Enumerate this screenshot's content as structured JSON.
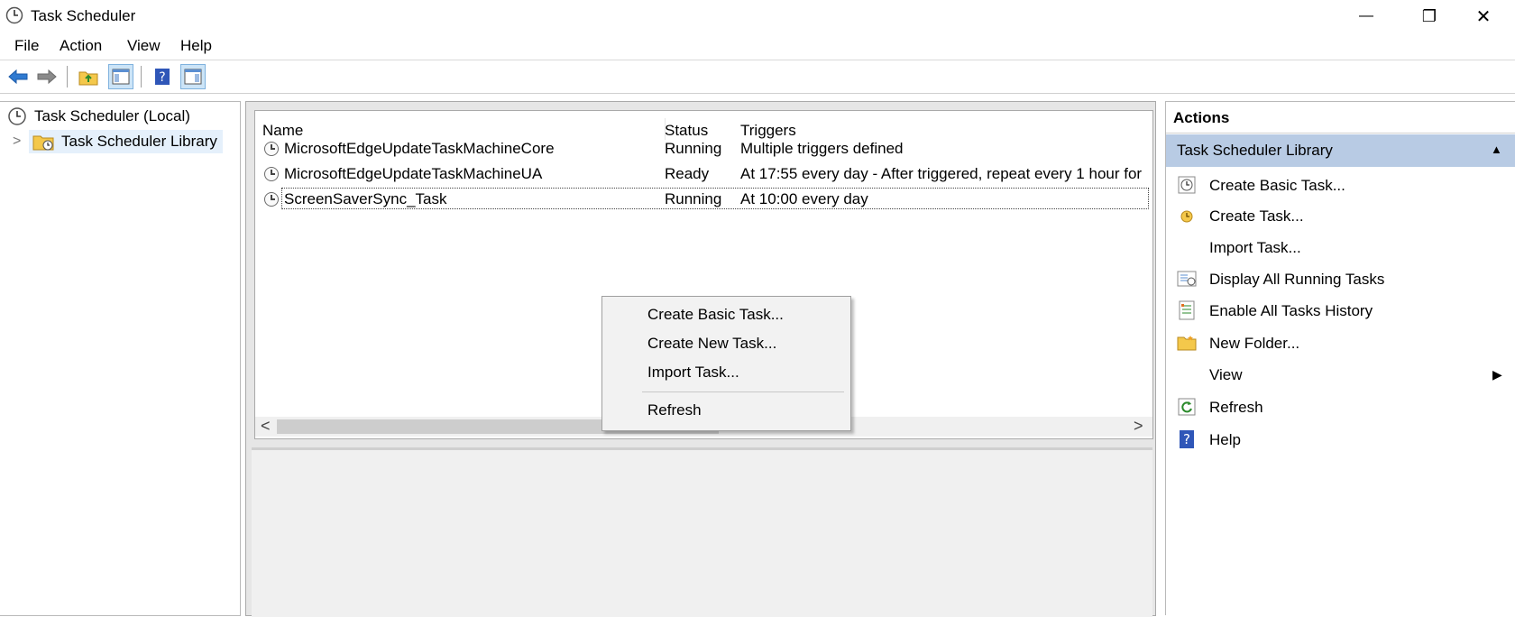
{
  "window": {
    "title": "Task Scheduler",
    "minimize_glyph": "—",
    "restore_glyph": "❐",
    "close_glyph": "✕"
  },
  "menu": [
    "File",
    "Action",
    "View",
    "Help"
  ],
  "tree": {
    "root": "Task Scheduler (Local)",
    "child": "Task Scheduler Library",
    "expander": ">"
  },
  "task_list": {
    "columns": [
      "Name",
      "Status",
      "Triggers"
    ],
    "rows": [
      {
        "name": "MicrosoftEdgeUpdateTaskMachineCore",
        "status": "Running",
        "triggers": "Multiple triggers defined"
      },
      {
        "name": "MicrosoftEdgeUpdateTaskMachineUA",
        "status": "Ready",
        "triggers": "At 17:55 every day - After triggered, repeat every 1 hour for"
      },
      {
        "name": "ScreenSaverSync_Task",
        "status": "Running",
        "triggers": "At 10:00 every day"
      }
    ],
    "scroll_left": "<",
    "scroll_right": ">"
  },
  "context_menu": {
    "items": [
      "Create Basic Task...",
      "Create New Task...",
      "Import Task...",
      "Refresh"
    ]
  },
  "actions": {
    "header": "Actions",
    "section": "Task Scheduler Library",
    "section_arrow": "▲",
    "items": [
      {
        "label": "Create Basic Task...",
        "icon": "basic-task-icon"
      },
      {
        "label": "Create Task...",
        "icon": "create-task-icon"
      },
      {
        "label": "Import Task...",
        "icon": ""
      },
      {
        "label": "Display All Running Tasks",
        "icon": "running-tasks-icon"
      },
      {
        "label": "Enable All Tasks History",
        "icon": "history-icon"
      },
      {
        "label": "New Folder...",
        "icon": "folder-icon"
      },
      {
        "label": "View",
        "icon": ""
      },
      {
        "label": "Refresh",
        "icon": "refresh-icon"
      },
      {
        "label": "Help",
        "icon": "help-icon"
      }
    ],
    "view_arrow": "▶"
  },
  "colors": {
    "selection_bg": "#cce8ff",
    "section_header_bg": "#b8cbe4",
    "arrow_blue": "#2f7ad1"
  }
}
